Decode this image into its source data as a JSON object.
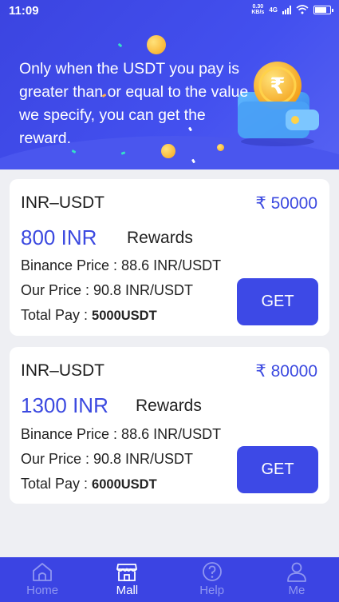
{
  "status_bar": {
    "time": "11:09",
    "net_speed_value": "0.30",
    "net_speed_unit": "KB/s",
    "network": "4G"
  },
  "banner": {
    "text": "Only when the USDT you pay is greater than or equal to the value we specify, you can get the reward.",
    "coin_symbol": "₹"
  },
  "cards": [
    {
      "pair": "INR–USDT",
      "amount": "₹ 50000",
      "reward": "800 INR",
      "reward_label": "Rewards",
      "binance_price": "Binance Price : 88.6 INR/USDT",
      "our_price": "Our Price : 90.8 INR/USDT",
      "total_pay_label": "Total Pay : ",
      "total_pay_value": "5000USDT",
      "button": "GET"
    },
    {
      "pair": "INR–USDT",
      "amount": "₹ 80000",
      "reward": "1300 INR",
      "reward_label": "Rewards",
      "binance_price": "Binance Price : 88.6 INR/USDT",
      "our_price": "Our Price : 90.8 INR/USDT",
      "total_pay_label": "Total Pay : ",
      "total_pay_value": "6000USDT",
      "button": "GET"
    }
  ],
  "nav": {
    "items": [
      {
        "label": "Home",
        "icon": "home-icon",
        "active": false
      },
      {
        "label": "Mall",
        "icon": "store-icon",
        "active": true
      },
      {
        "label": "Help",
        "icon": "help-icon",
        "active": false
      },
      {
        "label": "Me",
        "icon": "user-icon",
        "active": false
      }
    ]
  },
  "colors": {
    "primary": "#3d49e6",
    "background": "#eeeff3",
    "accent_text": "#3b49e0"
  }
}
